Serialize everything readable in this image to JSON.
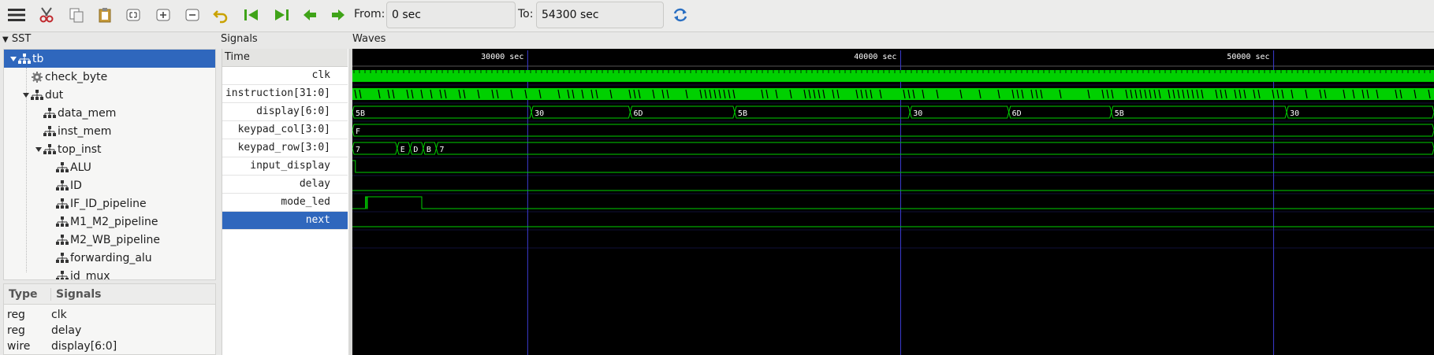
{
  "toolbar": {
    "from_label": "From:",
    "from_value": "0 sec",
    "to_label": "To:",
    "to_value": "54300 sec"
  },
  "panes": {
    "sst_title": "SST",
    "signals_title": "Signals",
    "waves_title": "Waves"
  },
  "tree": [
    {
      "label": "tb",
      "icon": "hierarchy-icon",
      "expanded": true,
      "selected": true,
      "indent": 0
    },
    {
      "label": "check_byte",
      "icon": "gear-icon",
      "expanded": null,
      "selected": false,
      "indent": 1
    },
    {
      "label": "dut",
      "icon": "hierarchy-icon",
      "expanded": true,
      "selected": false,
      "indent": 1
    },
    {
      "label": "data_mem",
      "icon": "hierarchy-icon",
      "expanded": null,
      "selected": false,
      "indent": 2
    },
    {
      "label": "inst_mem",
      "icon": "hierarchy-icon",
      "expanded": null,
      "selected": false,
      "indent": 2
    },
    {
      "label": "top_inst",
      "icon": "hierarchy-icon",
      "expanded": true,
      "selected": false,
      "indent": 2
    },
    {
      "label": "ALU",
      "icon": "hierarchy-icon",
      "expanded": null,
      "selected": false,
      "indent": 3
    },
    {
      "label": "ID",
      "icon": "hierarchy-icon",
      "expanded": null,
      "selected": false,
      "indent": 3
    },
    {
      "label": "IF_ID_pipeline",
      "icon": "hierarchy-icon",
      "expanded": null,
      "selected": false,
      "indent": 3
    },
    {
      "label": "M1_M2_pipeline",
      "icon": "hierarchy-icon",
      "expanded": null,
      "selected": false,
      "indent": 3
    },
    {
      "label": "M2_WB_pipeline",
      "icon": "hierarchy-icon",
      "expanded": null,
      "selected": false,
      "indent": 3
    },
    {
      "label": "forwarding_alu",
      "icon": "hierarchy-icon",
      "expanded": null,
      "selected": false,
      "indent": 3
    },
    {
      "label": "id_mux",
      "icon": "hierarchy-icon",
      "expanded": null,
      "selected": false,
      "indent": 3
    }
  ],
  "signals_table": {
    "col_type": "Type",
    "col_signals": "Signals",
    "rows": [
      {
        "type": "reg",
        "name": "clk"
      },
      {
        "type": "reg",
        "name": "delay"
      },
      {
        "type": "wire",
        "name": "display[6:0]"
      }
    ]
  },
  "signals": {
    "time_header": "Time",
    "rows": [
      {
        "name": "clk",
        "selected": false
      },
      {
        "name": "instruction[31:0]",
        "selected": false
      },
      {
        "name": "display[6:0]",
        "selected": false
      },
      {
        "name": "keypad_col[3:0]",
        "selected": false
      },
      {
        "name": "keypad_row[3:0]",
        "selected": false
      },
      {
        "name": "input_display",
        "selected": false
      },
      {
        "name": "delay",
        "selected": false
      },
      {
        "name": "mode_led",
        "selected": false
      },
      {
        "name": "next",
        "selected": true
      }
    ]
  },
  "waves": {
    "visible_range": [
      25300,
      54300
    ],
    "ticks": [
      {
        "time": 30000,
        "label": "30000 sec"
      },
      {
        "time": 40000,
        "label": "40000 sec"
      },
      {
        "time": 50000,
        "label": "50000 sec"
      }
    ],
    "display_segments": [
      {
        "start": 25300,
        "end": 30100,
        "label": "5B"
      },
      {
        "start": 30100,
        "end": 32750,
        "label": "30"
      },
      {
        "start": 32750,
        "end": 35550,
        "label": "6D"
      },
      {
        "start": 35550,
        "end": 40250,
        "label": "5B"
      },
      {
        "start": 40250,
        "end": 42900,
        "label": "30"
      },
      {
        "start": 42900,
        "end": 45650,
        "label": "6D"
      },
      {
        "start": 45650,
        "end": 50350,
        "label": "5B"
      },
      {
        "start": 50350,
        "end": 54300,
        "label": "30"
      }
    ],
    "keypad_col_segments": [
      {
        "start": 25300,
        "end": 54300,
        "label": "F"
      }
    ],
    "keypad_row_segments": [
      {
        "start": 25300,
        "end": 26500,
        "label": "7"
      },
      {
        "start": 26500,
        "end": 26850,
        "label": "E"
      },
      {
        "start": 26850,
        "end": 27200,
        "label": "D"
      },
      {
        "start": 27200,
        "end": 27550,
        "label": "B"
      },
      {
        "start": 27550,
        "end": 54300,
        "label": "7"
      }
    ],
    "colors": {
      "trace": "#00d000",
      "grid": "#3a3ad0",
      "background": "#000000"
    }
  }
}
